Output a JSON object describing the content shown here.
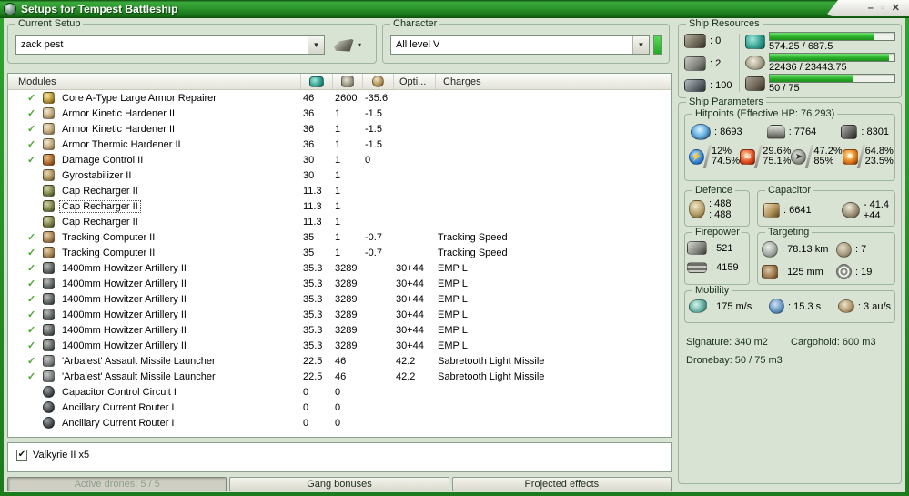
{
  "window": {
    "title": "Setups for Tempest Battleship",
    "controls": {
      "minimize": "–",
      "maximize": "▫",
      "close": "✕"
    }
  },
  "current_setup": {
    "label": "Current Setup",
    "value": "zack pest",
    "dropdown_glyph": "▼",
    "tool_arrow": "▾"
  },
  "character": {
    "label": "Character",
    "value": "All level V",
    "dropdown_glyph": "▼"
  },
  "ship_resources": {
    "label": "Ship Resources",
    "turret_hardpoints": ": 0",
    "launcher_hardpoints": ": 2",
    "calibration": ": 100",
    "bars": [
      {
        "name": "cpu",
        "text": "574.25 / 687.5",
        "pct": 83.5
      },
      {
        "name": "powergrid",
        "text": "22436 / 23443.75",
        "pct": 95.7
      },
      {
        "name": "bandwidth",
        "text": "50 / 75",
        "pct": 66.7
      }
    ]
  },
  "ship_parameters": {
    "label": "Ship Parameters",
    "hitpoints": {
      "label": "Hitpoints (Effective HP: 76,293)",
      "shield": ": 8693",
      "armor": ": 7764",
      "structure": ": 8301",
      "resists": [
        {
          "type": "em",
          "glyph": "⚡",
          "top": "12%",
          "bottom": "74.5%"
        },
        {
          "type": "thermal",
          "glyph": "≋",
          "top": "29.6%",
          "bottom": "75.1%"
        },
        {
          "type": "kinetic",
          "glyph": "➤",
          "top": "47.2%",
          "bottom": "85%"
        },
        {
          "type": "explosive",
          "glyph": "✸",
          "top": "64.8%",
          "bottom": "23.5%"
        }
      ]
    },
    "defence": {
      "label": "Defence",
      "value1": ": 488",
      "value2": ": 488"
    },
    "capacitor": {
      "label": "Capacitor",
      "amount": ": 6641",
      "boost_neg": "- 41.4",
      "boost_pos": "+44"
    },
    "firepower": {
      "label": "Firepower",
      "turret": ": 521",
      "volley": ": 4159"
    },
    "targeting": {
      "label": "Targeting",
      "range": ": 78.13 km",
      "max_targets": ": 7",
      "scan_res": ": 125 mm",
      "sensor_strength": ": 19"
    },
    "mobility": {
      "label": "Mobility",
      "speed": ": 175 m/s",
      "align_time": ": 15.3 s",
      "warp_speed": ": 3 au/s"
    },
    "signature": "Signature: 340 m2",
    "cargohold": "Cargohold: 600 m3",
    "dronebay": "Dronebay: 50 / 75 m3"
  },
  "modules": {
    "headers": {
      "modules": "Modules",
      "opti": "Opti...",
      "charges": "Charges"
    },
    "rows": [
      {
        "active": true,
        "icon": "armor-repairer",
        "name": "Core A-Type Large Armor Repairer",
        "cpu": "46",
        "pg": "2600",
        "cap": "-35.6",
        "opti": "",
        "charges": ""
      },
      {
        "active": true,
        "icon": "hardener",
        "name": "Armor Kinetic Hardener II",
        "cpu": "36",
        "pg": "1",
        "cap": "-1.5",
        "opti": "",
        "charges": ""
      },
      {
        "active": true,
        "icon": "hardener",
        "name": "Armor Kinetic Hardener II",
        "cpu": "36",
        "pg": "1",
        "cap": "-1.5",
        "opti": "",
        "charges": ""
      },
      {
        "active": true,
        "icon": "hardener",
        "name": "Armor Thermic Hardener II",
        "cpu": "36",
        "pg": "1",
        "cap": "-1.5",
        "opti": "",
        "charges": ""
      },
      {
        "active": true,
        "icon": "damage-control",
        "name": "Damage Control II",
        "cpu": "30",
        "pg": "1",
        "cap": "0",
        "opti": "",
        "charges": ""
      },
      {
        "active": false,
        "icon": "gyrostabilizer",
        "name": "Gyrostabilizer II",
        "cpu": "30",
        "pg": "1",
        "cap": "",
        "opti": "",
        "charges": ""
      },
      {
        "active": false,
        "icon": "cap-recharger",
        "name": "Cap Recharger II",
        "cpu": "11.3",
        "pg": "1",
        "cap": "",
        "opti": "",
        "charges": ""
      },
      {
        "active": false,
        "icon": "cap-recharger",
        "name": "Cap Recharger II",
        "cpu": "11.3",
        "pg": "1",
        "cap": "",
        "opti": "",
        "charges": "",
        "focused": true
      },
      {
        "active": false,
        "icon": "cap-recharger",
        "name": "Cap Recharger II",
        "cpu": "11.3",
        "pg": "1",
        "cap": "",
        "opti": "",
        "charges": ""
      },
      {
        "active": true,
        "icon": "tracking-computer",
        "name": "Tracking Computer II",
        "cpu": "35",
        "pg": "1",
        "cap": "-0.7",
        "opti": "",
        "charges": "Tracking Speed"
      },
      {
        "active": true,
        "icon": "tracking-computer",
        "name": "Tracking Computer II",
        "cpu": "35",
        "pg": "1",
        "cap": "-0.7",
        "opti": "",
        "charges": "Tracking Speed"
      },
      {
        "active": true,
        "icon": "artillery",
        "name": "1400mm Howitzer Artillery II",
        "cpu": "35.3",
        "pg": "3289",
        "cap": "",
        "opti": "30+44",
        "charges": "EMP L"
      },
      {
        "active": true,
        "icon": "artillery",
        "name": "1400mm Howitzer Artillery II",
        "cpu": "35.3",
        "pg": "3289",
        "cap": "",
        "opti": "30+44",
        "charges": "EMP L"
      },
      {
        "active": true,
        "icon": "artillery",
        "name": "1400mm Howitzer Artillery II",
        "cpu": "35.3",
        "pg": "3289",
        "cap": "",
        "opti": "30+44",
        "charges": "EMP L"
      },
      {
        "active": true,
        "icon": "artillery",
        "name": "1400mm Howitzer Artillery II",
        "cpu": "35.3",
        "pg": "3289",
        "cap": "",
        "opti": "30+44",
        "charges": "EMP L"
      },
      {
        "active": true,
        "icon": "artillery",
        "name": "1400mm Howitzer Artillery II",
        "cpu": "35.3",
        "pg": "3289",
        "cap": "",
        "opti": "30+44",
        "charges": "EMP L"
      },
      {
        "active": true,
        "icon": "artillery",
        "name": "1400mm Howitzer Artillery II",
        "cpu": "35.3",
        "pg": "3289",
        "cap": "",
        "opti": "30+44",
        "charges": "EMP L"
      },
      {
        "active": true,
        "icon": "missile-launcher",
        "name": "'Arbalest' Assault Missile Launcher",
        "cpu": "22.5",
        "pg": "46",
        "cap": "",
        "opti": "42.2",
        "charges": "Sabretooth Light Missile"
      },
      {
        "active": true,
        "icon": "missile-launcher",
        "name": "'Arbalest' Assault Missile Launcher",
        "cpu": "22.5",
        "pg": "46",
        "cap": "",
        "opti": "42.2",
        "charges": "Sabretooth Light Missile"
      },
      {
        "active": false,
        "icon": "rig",
        "name": "Capacitor Control Circuit I",
        "cpu": "0",
        "pg": "0",
        "cap": "",
        "opti": "",
        "charges": ""
      },
      {
        "active": false,
        "icon": "rig",
        "name": "Ancillary Current Router I",
        "cpu": "0",
        "pg": "0",
        "cap": "",
        "opti": "",
        "charges": ""
      },
      {
        "active": false,
        "icon": "rig",
        "name": "Ancillary Current Router I",
        "cpu": "0",
        "pg": "0",
        "cap": "",
        "opti": "",
        "charges": ""
      }
    ]
  },
  "drones": {
    "items": [
      {
        "label": "Valkyrie II x5",
        "checked": true,
        "check_glyph": "✔"
      }
    ]
  },
  "bottom_tabs": [
    {
      "label": "Active drones: 5 / 5",
      "active": true
    },
    {
      "label": "Gang bonuses",
      "active": false
    },
    {
      "label": "Projected effects",
      "active": false
    }
  ],
  "colors": {
    "accent_green": "#2c962c",
    "bar_fill": "#27ad27",
    "check_green": "#4aa832"
  }
}
